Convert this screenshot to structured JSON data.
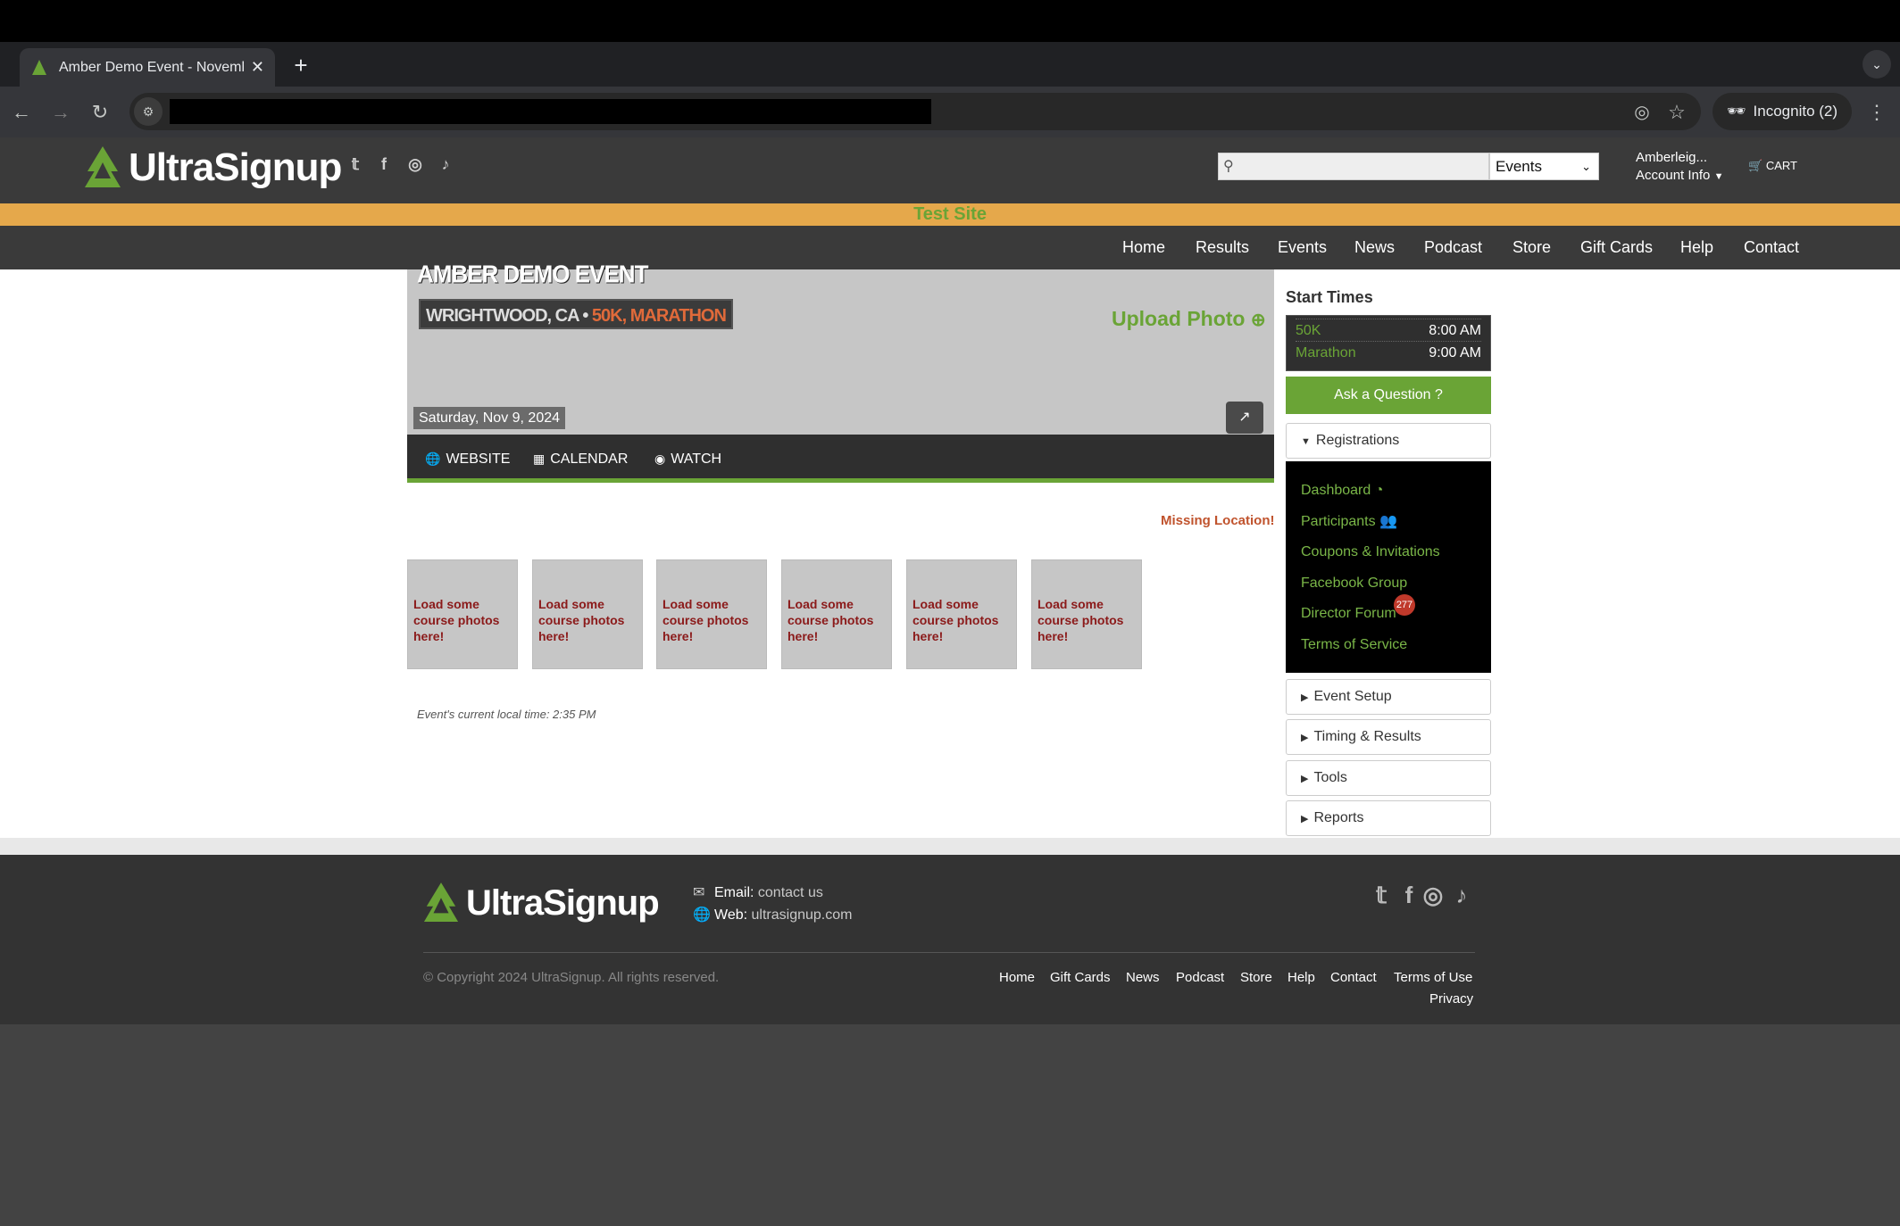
{
  "browser": {
    "tab_title": "Amber Demo Event - Novemb",
    "tab_close": "✕",
    "new_tab": "+",
    "url": "",
    "incognito_label": "Incognito (2)"
  },
  "header": {
    "logo_text": "UltraSignup",
    "search_placeholder": "",
    "search_scope": "Events",
    "account_name": "Amberleig...",
    "account_info": "Account Info",
    "cart_label": "CART"
  },
  "banner": {
    "test_site": "Test Site"
  },
  "nav": [
    "Home",
    "Results",
    "Events",
    "News",
    "Podcast",
    "Store",
    "Gift Cards",
    "Help",
    "Contact"
  ],
  "event": {
    "title": "AMBER DEMO EVENT",
    "location": "WRIGHTWOOD, CA",
    "separator": " • ",
    "distances": "50K, MARATHON",
    "upload_photo": "Upload Photo",
    "date": "Saturday, Nov 9, 2024",
    "links": {
      "website": "WEBSITE",
      "calendar": "CALENDAR",
      "watch": "WATCH"
    },
    "missing_location": "Missing Location!",
    "photo_placeholder": "Load some course photos here!",
    "local_time": "Event's current local time: 2:35 PM"
  },
  "sidebar": {
    "start_times_title": "Start Times",
    "start_times": [
      {
        "name": "50K",
        "time": "8:00 AM"
      },
      {
        "name": "Marathon",
        "time": "9:00 AM"
      }
    ],
    "ask_question": "Ask a Question",
    "registrations": "Registrations",
    "reg_links": [
      "Dashboard",
      "Participants",
      "Coupons & Invitations",
      "Facebook Group",
      "Director Forum",
      "Terms of Service"
    ],
    "forum_badge": "277",
    "sections": [
      "Event Setup",
      "Timing & Results",
      "Tools",
      "Reports"
    ]
  },
  "footer": {
    "logo_text": "UltraSignup",
    "email_label": "Email:",
    "email_value": "contact us",
    "web_label": "Web:",
    "web_value": "ultrasignup.com",
    "copyright": "© Copyright 2024 UltraSignup. All rights reserved.",
    "links": [
      "Home",
      "Gift Cards",
      "News",
      "Podcast",
      "Store",
      "Help",
      "Contact",
      "Terms of Use"
    ],
    "privacy": "Privacy"
  },
  "colors": {
    "accent": "#6aa436",
    "banner": "#e5a84b",
    "header": "#3a3a3a",
    "alert": "#c0532d"
  }
}
